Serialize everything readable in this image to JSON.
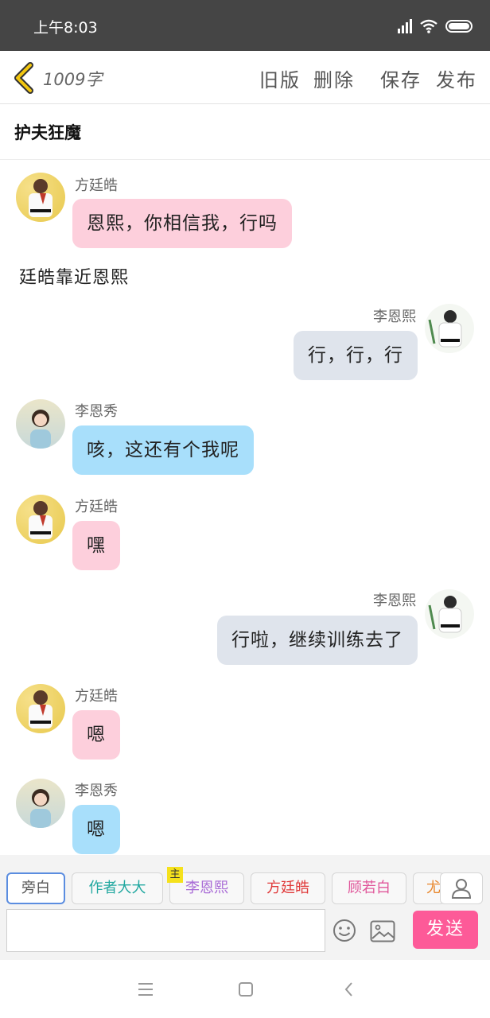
{
  "status_bar": {
    "time": "上午8:03"
  },
  "toolbar": {
    "word_count": "1009字",
    "old_version": "旧版",
    "delete": "删除",
    "save": "保存",
    "publish": "发布"
  },
  "story": {
    "title": "护夫狂魔"
  },
  "chat": {
    "messages": [
      {
        "speaker": "方廷皓",
        "text": "恩熙，你相信我，行吗"
      },
      {
        "narration": "廷皓靠近恩熙"
      },
      {
        "speaker": "李恩熙",
        "text": "行，行，行"
      },
      {
        "speaker": "李恩秀",
        "text": "咳，这还有个我呢"
      },
      {
        "speaker": "方廷皓",
        "text": "嘿"
      },
      {
        "speaker": "李恩熙",
        "text": "行啦，继续训练去了"
      },
      {
        "speaker": "方廷皓",
        "text": "嗯"
      },
      {
        "speaker": "李恩秀",
        "text": "嗯"
      }
    ]
  },
  "roles": {
    "chips": [
      "旁白",
      "作者大大",
      "李恩熙",
      "方廷皓",
      "顾若白",
      "尤"
    ],
    "main_badge": "主",
    "selected": "旁白"
  },
  "composer": {
    "input_value": "",
    "send_label": "发送"
  },
  "colors": {
    "status_bar": "#454545",
    "pink_bubble": "#fdcfdc",
    "blue_bubble": "#a8dffb",
    "gray_bubble": "#dfe4ec",
    "send_button": "#fd5a98",
    "back_arrow": "#e6b800"
  },
  "icons": {
    "back": "chevron-left-icon",
    "signal": "signal-icon",
    "wifi": "wifi-icon",
    "battery": "battery-icon",
    "user": "user-icon",
    "emoji": "smiley-icon",
    "image": "image-icon",
    "nav_menu": "menu-icon",
    "nav_home": "square-icon",
    "nav_back": "back-icon"
  }
}
